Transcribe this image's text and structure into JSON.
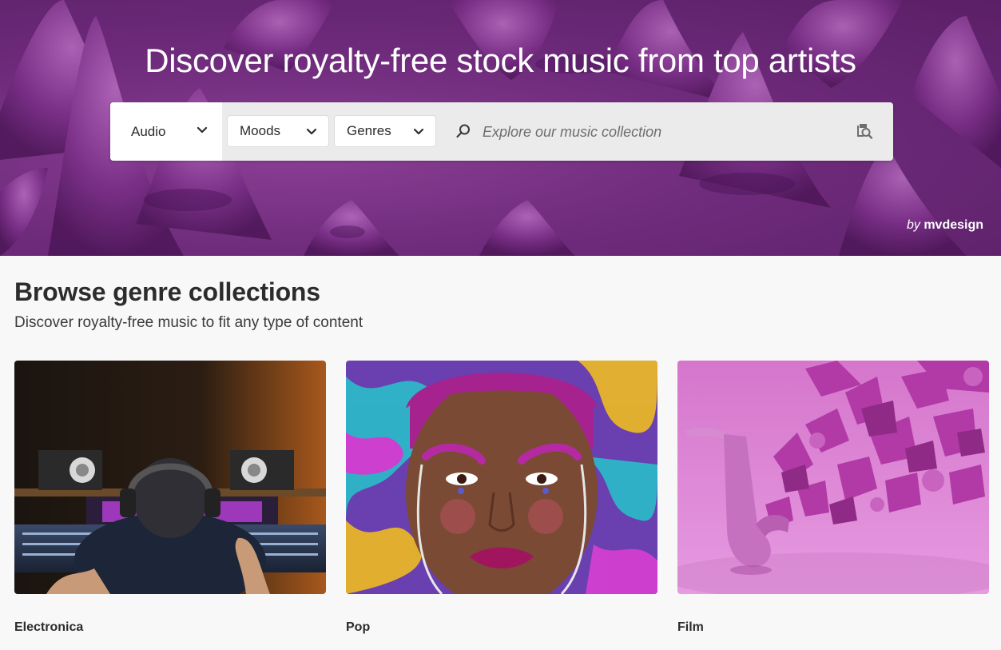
{
  "hero": {
    "title": "Discover royalty-free stock music from top artists",
    "credit_by": "by",
    "credit_author": "mvdesign"
  },
  "search": {
    "asset_type": "Audio",
    "moods_label": "Moods",
    "genres_label": "Genres",
    "placeholder": "Explore our music collection",
    "search_icon": "search-icon",
    "visual_search_icon": "visual-search-icon"
  },
  "browse": {
    "title": "Browse genre collections",
    "subtitle": "Discover royalty-free music to fit any type of content",
    "collections": [
      {
        "label": "Electronica"
      },
      {
        "label": "Pop"
      },
      {
        "label": "Film"
      }
    ]
  },
  "colors": {
    "hero_purple": "#6f2b7c",
    "accent_pink": "#d05ac8",
    "text_dark": "#2c2c2c"
  }
}
